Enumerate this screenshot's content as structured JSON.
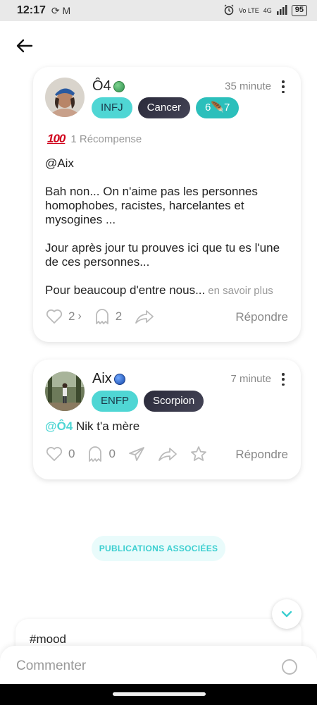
{
  "status_bar": {
    "time": "12:17",
    "left_icons": "⟳ M",
    "network": "Vo LTE",
    "signal_label": "4G",
    "battery": "95"
  },
  "post": {
    "author": "Ô4",
    "time": "35 minute",
    "tags": [
      "INFJ",
      "Cancer",
      "6🪶7"
    ],
    "award_icon_text": "100",
    "award_label": "1 Récompense",
    "paragraphs": [
      "@Aix",
      "Bah non... On n'aime pas les personnes homophobes, racistes, harcelantes et mysogines ...",
      "Jour après jour tu prouves ici que tu es l'une de ces personnes...",
      "Pour beaucoup d'entre nous..."
    ],
    "see_more": "en savoir plus",
    "like_count": "2",
    "comment_count": "2",
    "reply_label": "Répondre"
  },
  "comment": {
    "author": "Aix",
    "time": "7 minute",
    "tags": [
      "ENFP",
      "Scorpion"
    ],
    "mention": "@Ô4",
    "text": " Nik t'a mère",
    "like_count": "0",
    "comment_count": "0",
    "reply_label": "Répondre"
  },
  "related_button": "PUBLICATIONS ASSOCIÉES",
  "preview": {
    "text": "#mood"
  },
  "comment_bar": {
    "placeholder": "Commenter"
  },
  "colors": {
    "accent": "#4fd6d4",
    "accent_dark": "#2bbfbb"
  }
}
